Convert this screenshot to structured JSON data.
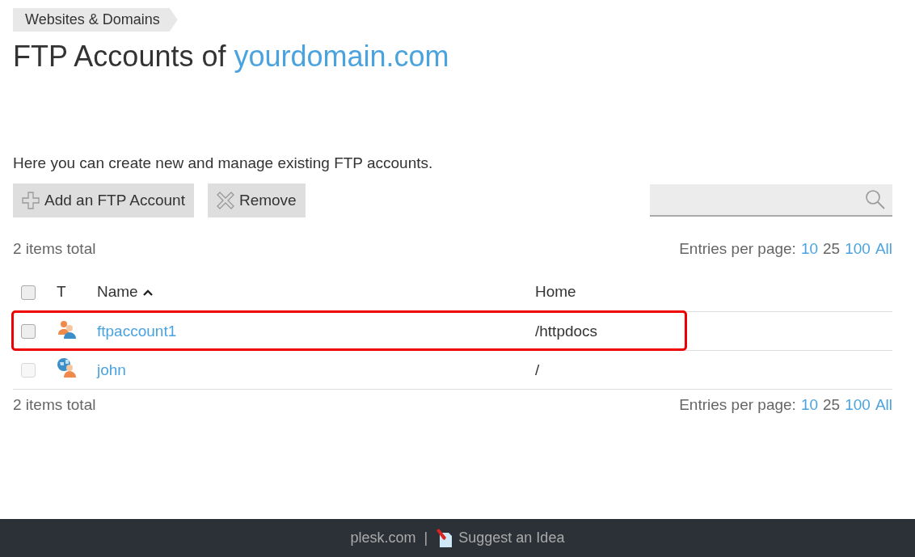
{
  "breadcrumb": "Websites & Domains",
  "title": {
    "prefix": "FTP Accounts of",
    "domain": "yourdomain.com"
  },
  "description": "Here you can create new and manage existing FTP accounts.",
  "toolbar": {
    "buttons": [
      {
        "kind": "add",
        "label": "Add an FTP Account"
      },
      {
        "kind": "remove",
        "label": "Remove"
      }
    ]
  },
  "pagers": [
    {
      "total": "2 items total",
      "label": "Entries per page:",
      "options": [
        {
          "label": "10",
          "selected": false
        },
        {
          "label": "25",
          "selected": true
        },
        {
          "label": "100",
          "selected": false
        },
        {
          "label": "All",
          "selected": false
        }
      ]
    },
    {
      "total": "2 items total",
      "label": "Entries per page:",
      "options": [
        {
          "label": "10",
          "selected": false
        },
        {
          "label": "25",
          "selected": true
        },
        {
          "label": "100",
          "selected": false
        },
        {
          "label": "All",
          "selected": false
        }
      ]
    }
  ],
  "table": {
    "select_all": {
      "checked": false
    },
    "columns": [
      {
        "label": "T"
      },
      {
        "label": "Name",
        "sorted": true
      },
      {
        "label": "Home"
      }
    ],
    "rows": [
      {
        "kind": "ftp-user",
        "name": "ftpaccount1",
        "home": "/httpdocs",
        "checked": false,
        "disabled": false,
        "highlighted": true
      },
      {
        "kind": "system-user",
        "name": "john",
        "home": "/",
        "checked": false,
        "disabled": true,
        "highlighted": false
      }
    ]
  },
  "footer": {
    "link": "plesk.com",
    "separator": "|",
    "idea": "Suggest an Idea"
  }
}
